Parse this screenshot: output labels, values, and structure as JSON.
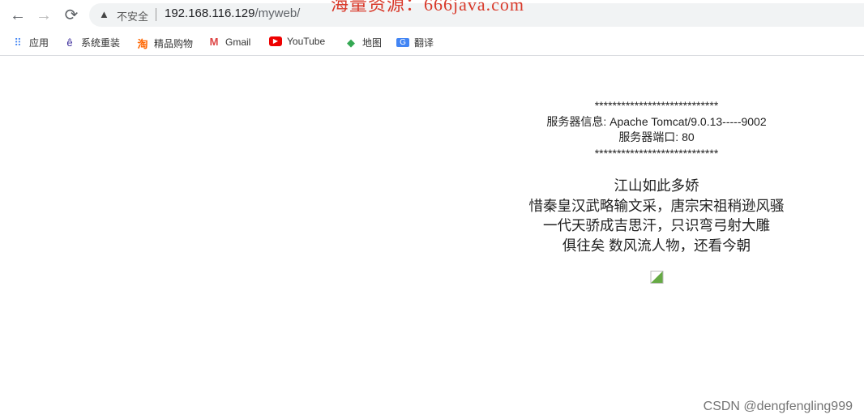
{
  "browser": {
    "back_icon": "arrow-left",
    "forward_icon": "arrow-right",
    "reload_icon": "reload",
    "security_label": "不安全",
    "url_host": "192.168.116.129",
    "url_path": "/myweb/",
    "overlay_text": "海量资源：666java.com"
  },
  "bookmarks": [
    {
      "label": "应用",
      "icon": "apps-grid"
    },
    {
      "label": "系统重装",
      "icon": "system-reinstall"
    },
    {
      "label": "精品购物",
      "icon": "taobao"
    },
    {
      "label": "Gmail",
      "icon": "gmail"
    },
    {
      "label": "YouTube",
      "icon": "youtube"
    },
    {
      "label": "地图",
      "icon": "maps"
    },
    {
      "label": "翻译",
      "icon": "translate"
    }
  ],
  "page": {
    "stars": "****************************",
    "server_info": "服务器信息: Apache Tomcat/9.0.13-----9002",
    "server_port": "服务器端口: 80",
    "poem": [
      "江山如此多娇",
      "惜秦皇汉武略输文采，唐宗宋祖稍逊风骚",
      "一代天骄成吉思汗，只识弯弓射大雕",
      "俱往矣 数风流人物，还看今朝"
    ]
  },
  "watermark": "CSDN @dengfengling999"
}
